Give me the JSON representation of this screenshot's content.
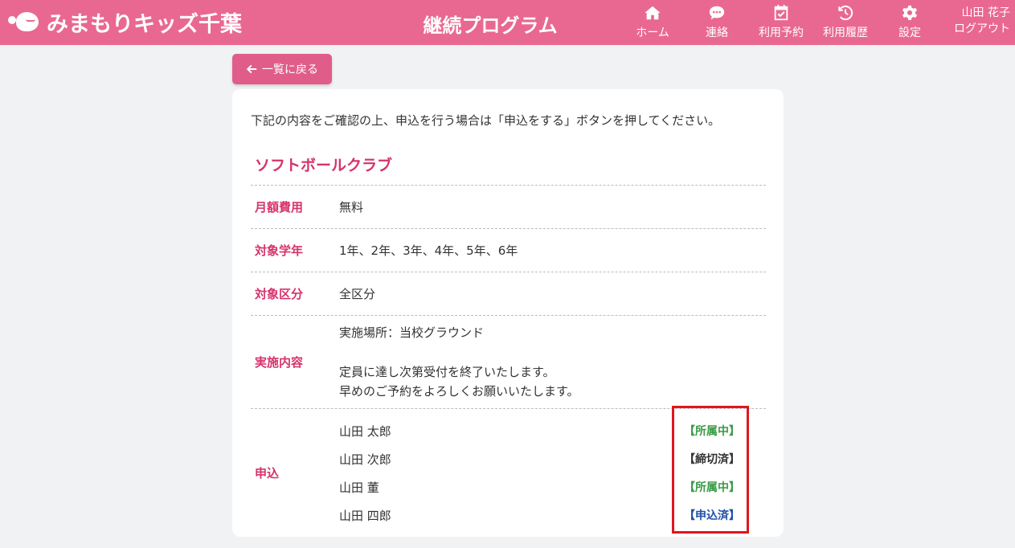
{
  "header": {
    "logo_text": "みまもりキッズ千葉",
    "title": "継続プログラム",
    "nav": [
      {
        "label": "ホーム",
        "icon": "home-icon"
      },
      {
        "label": "連絡",
        "icon": "chat-icon"
      },
      {
        "label": "利用予約",
        "icon": "calendar-check-icon"
      },
      {
        "label": "利用履歴",
        "icon": "history-icon"
      },
      {
        "label": "設定",
        "icon": "gear-icon"
      }
    ],
    "user_name": "山田 花子",
    "logout_label": "ログアウト",
    "bg_color": "#e96891"
  },
  "back_button": {
    "label": "一覧に戻る"
  },
  "content": {
    "intro": "下記の内容をご確認の上、申込を行う場合は「申込をする」ボタンを押してください。",
    "program_name": "ソフトボールクラブ",
    "rows": [
      {
        "label": "月額費用",
        "value": "無料"
      },
      {
        "label": "対象学年",
        "value": "1年、2年、3年、4年、5年、6年"
      },
      {
        "label": "対象区分",
        "value": "全区分"
      }
    ],
    "details": {
      "label": "実施内容",
      "line1": "実施場所：当校グラウンド",
      "line2": "定員に達し次第受付を終了いたします。",
      "line3": "早めのご予約をよろしくお願いいたします。"
    },
    "apply": {
      "label": "申込",
      "children": [
        {
          "name": "山田 太郎",
          "status": "【所属中】",
          "color": "green"
        },
        {
          "name": "山田 次郎",
          "status": "【締切済】",
          "color": "black"
        },
        {
          "name": "山田 董",
          "status": "【所属中】",
          "color": "green"
        },
        {
          "name": "山田 四郎",
          "status": "【申込済】",
          "color": "blue"
        }
      ]
    }
  }
}
